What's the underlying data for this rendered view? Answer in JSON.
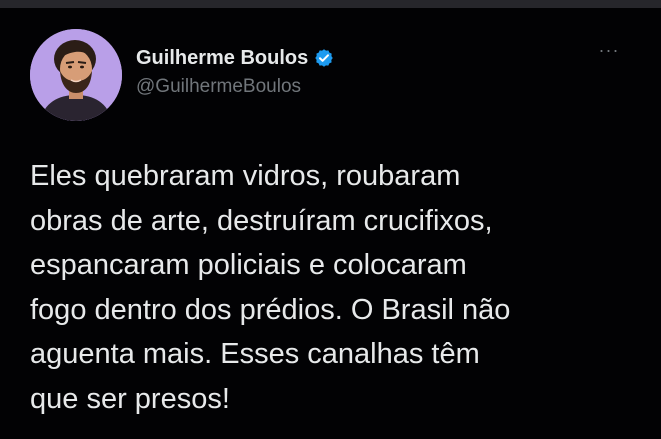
{
  "tweet": {
    "author": {
      "display_name": "Guilherme Boulos",
      "handle": "@GuilhermeBoulos",
      "verified": true,
      "avatar_icon": "avatar-portrait"
    },
    "more_icon": "more-horizontal-icon",
    "more_glyph": "···",
    "text": "Eles quebraram vidros, roubaram\nobras de arte, destruíram crucifixos,\nespancaram policiais e colocaram\nfogo dentro dos prédios. O Brasil não\naguenta mais. Esses canalhas têm\nque ser presos!"
  },
  "colors": {
    "background": "#000000",
    "text_primary": "#e7e9ea",
    "text_secondary": "#71767b",
    "verified_blue": "#1d9bf0",
    "avatar_bg": "#b99fe8"
  }
}
